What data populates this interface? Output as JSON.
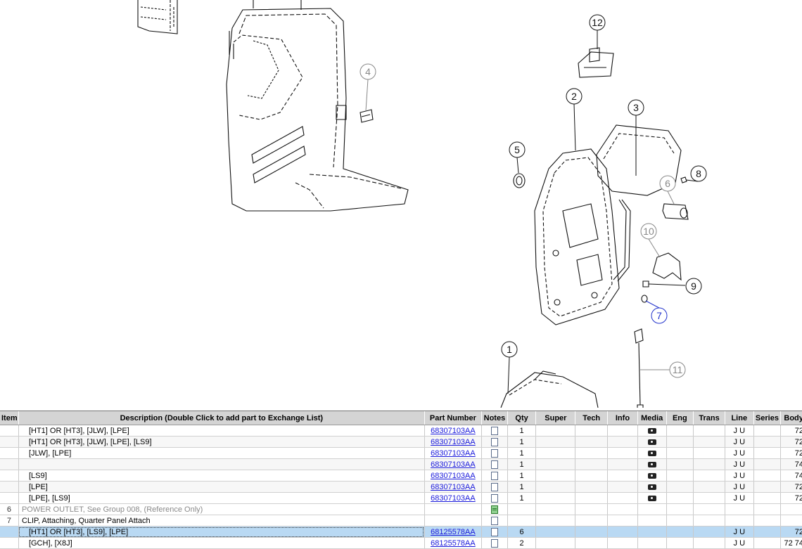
{
  "diagram": {
    "callouts": [
      "1",
      "2",
      "3",
      "4",
      "5",
      "6",
      "7",
      "8",
      "9",
      "10",
      "11",
      "12"
    ]
  },
  "table": {
    "columns": [
      "Item",
      "Description (Double Click to add part to Exchange List)",
      "Part Number",
      "Notes",
      "Qty",
      "Super",
      "Tech",
      "Info",
      "Media",
      "Eng",
      "Trans",
      "Line",
      "Series",
      "Body"
    ],
    "rows": [
      {
        "item": "",
        "desc": "[HT1] OR [HT3], [JLW], [LPE]",
        "pn": "68307103AA",
        "notes": "note",
        "qty": "1",
        "media": "camera",
        "line": "J U",
        "body": "72",
        "kind": "sub"
      },
      {
        "item": "",
        "desc": "[HT1] OR [HT3], [JLW], [LPE], [LS9]",
        "pn": "68307103AA",
        "notes": "note",
        "qty": "1",
        "media": "camera",
        "line": "J U",
        "body": "72",
        "kind": "sub"
      },
      {
        "item": "",
        "desc": "[JLW], [LPE]",
        "pn": "68307103AA",
        "notes": "note",
        "qty": "1",
        "media": "camera",
        "line": "J U",
        "body": "72",
        "kind": "sub"
      },
      {
        "item": "",
        "desc": "",
        "pn": "68307103AA",
        "notes": "note",
        "qty": "1",
        "media": "camera",
        "line": "J U",
        "body": "74",
        "kind": "sub"
      },
      {
        "item": "",
        "desc": "[LS9]",
        "pn": "68307103AA",
        "notes": "note",
        "qty": "1",
        "media": "camera",
        "line": "J U",
        "body": "74",
        "kind": "sub"
      },
      {
        "item": "",
        "desc": "[LPE]",
        "pn": "68307103AA",
        "notes": "note",
        "qty": "1",
        "media": "camera",
        "line": "J U",
        "body": "72",
        "kind": "sub"
      },
      {
        "item": "",
        "desc": "[LPE], [LS9]",
        "pn": "68307103AA",
        "notes": "note",
        "qty": "1",
        "media": "camera",
        "line": "J U",
        "body": "72",
        "kind": "sub"
      },
      {
        "item": "6",
        "desc": "POWER OUTLET, See Group 008, (Reference Only)",
        "pn": "",
        "notes": "note-filled",
        "qty": "",
        "media": "",
        "line": "",
        "body": "",
        "kind": "ref"
      },
      {
        "item": "7",
        "desc": "CLIP, Attaching, Quarter Panel Attach",
        "pn": "",
        "notes": "note",
        "qty": "",
        "media": "",
        "line": "",
        "body": "",
        "kind": "group"
      },
      {
        "item": "",
        "desc": "[HT1] OR [HT3], [LS9], [LPE]",
        "pn": "68125578AA",
        "notes": "note",
        "qty": "6",
        "media": "",
        "line": "J U",
        "body": "72",
        "kind": "selected"
      },
      {
        "item": "",
        "desc": "[GCH], [X8J]",
        "pn": "68125578AA",
        "notes": "note",
        "qty": "2",
        "media": "",
        "line": "J U",
        "body": "72 74",
        "kind": "sub"
      }
    ]
  }
}
